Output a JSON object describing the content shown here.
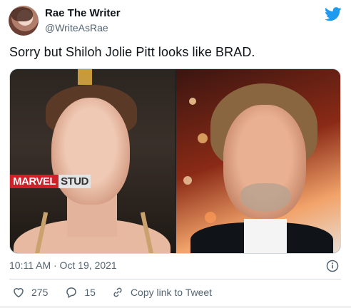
{
  "author": {
    "name": "Rae The Writer",
    "handle": "@WriteAsRae"
  },
  "tweet": {
    "text": "Sorry but Shiloh Jolie Pitt looks like BRAD.",
    "timestamp": "10:11 AM · Oct 19, 2021"
  },
  "media": {
    "left_banner_marvel": "MARVEL",
    "left_banner_studios": "STUD"
  },
  "actions": {
    "likes": "275",
    "replies": "15",
    "copy_link_label": "Copy link to Tweet"
  },
  "icons": {
    "twitter": "twitter-bird-icon",
    "info": "info-icon",
    "like": "heart-icon",
    "reply": "reply-icon",
    "copy": "link-icon"
  },
  "colors": {
    "twitter_blue": "#1d9bf0",
    "text_primary": "#0f1419",
    "text_secondary": "#536471"
  }
}
